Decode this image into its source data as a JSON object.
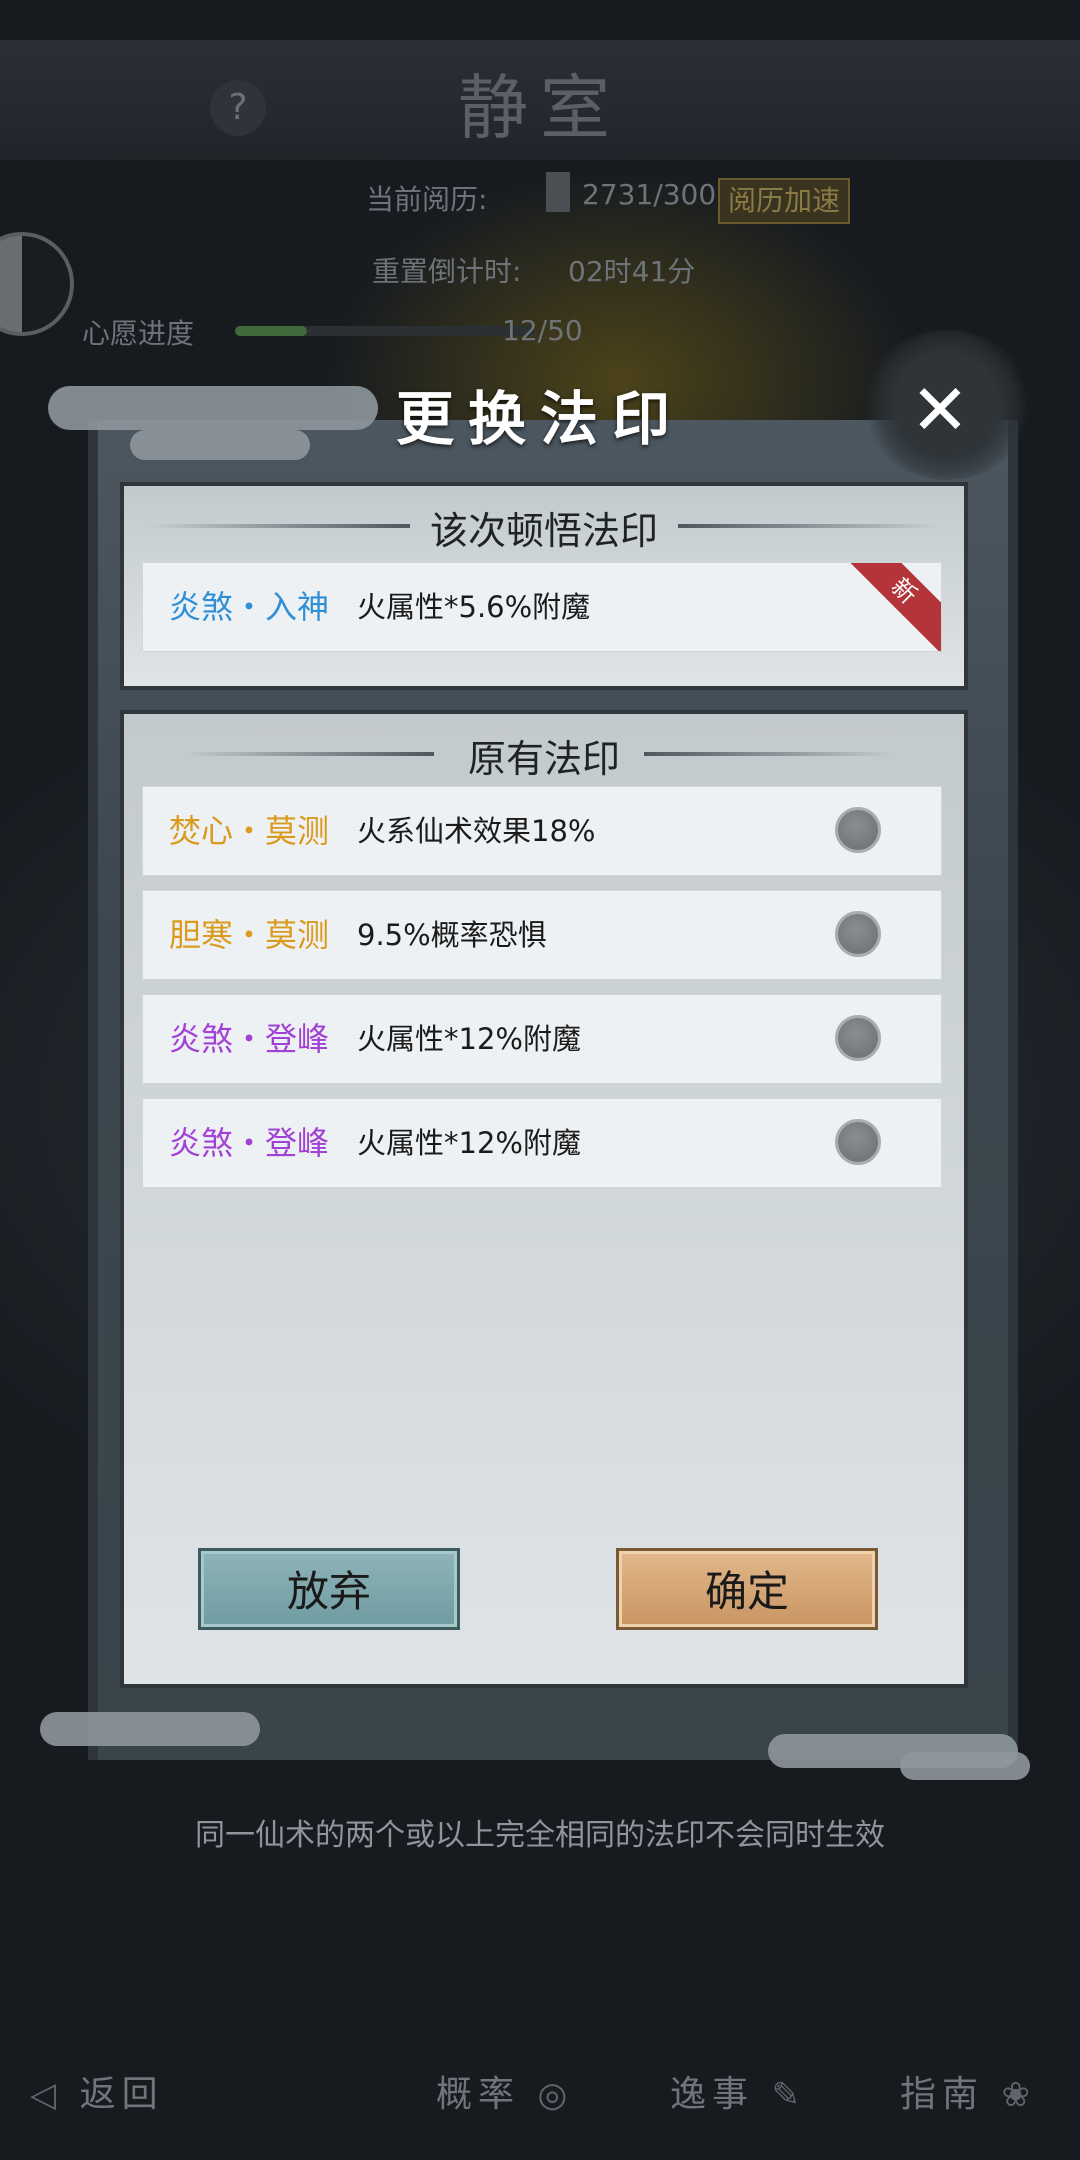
{
  "background": {
    "room_title": "静室",
    "help_label": "?",
    "experience_label": "当前阅历:",
    "experience_value": "2731/300",
    "boost_label": "阅历加速",
    "reset_label": "重置倒计时:",
    "reset_value": "02时41分",
    "wish_label": "心愿进度",
    "wish_value": "12/50",
    "wish_progress_fraction": 0.24
  },
  "modal": {
    "title": "更换法印",
    "close_label": "✕",
    "new_section": {
      "heading": "该次顿悟法印",
      "seal": {
        "name": "炎煞・入神",
        "desc": "火属性*5.6%附魔",
        "color": "#2f8fd6",
        "badge": "新"
      }
    },
    "original_section": {
      "heading": "原有法印",
      "seals": [
        {
          "name": "焚心・莫测",
          "desc": "火系仙术效果18%",
          "color": "#d99a1d"
        },
        {
          "name": "胆寒・莫测",
          "desc": "9.5%概率恐惧",
          "color": "#d99a1d"
        },
        {
          "name": "炎煞・登峰",
          "desc": "火属性*12%附魔",
          "color": "#a141d6"
        },
        {
          "name": "炎煞・登峰",
          "desc": "火属性*12%附魔",
          "color": "#a141d6"
        }
      ]
    },
    "cancel_label": "放弃",
    "confirm_label": "确定"
  },
  "hint": "同一仙术的两个或以上完全相同的法印不会同时生效",
  "bottom_nav": {
    "back_label": "返回",
    "rate_label": "概率",
    "story_label": "逸事",
    "guide_label": "指南"
  }
}
